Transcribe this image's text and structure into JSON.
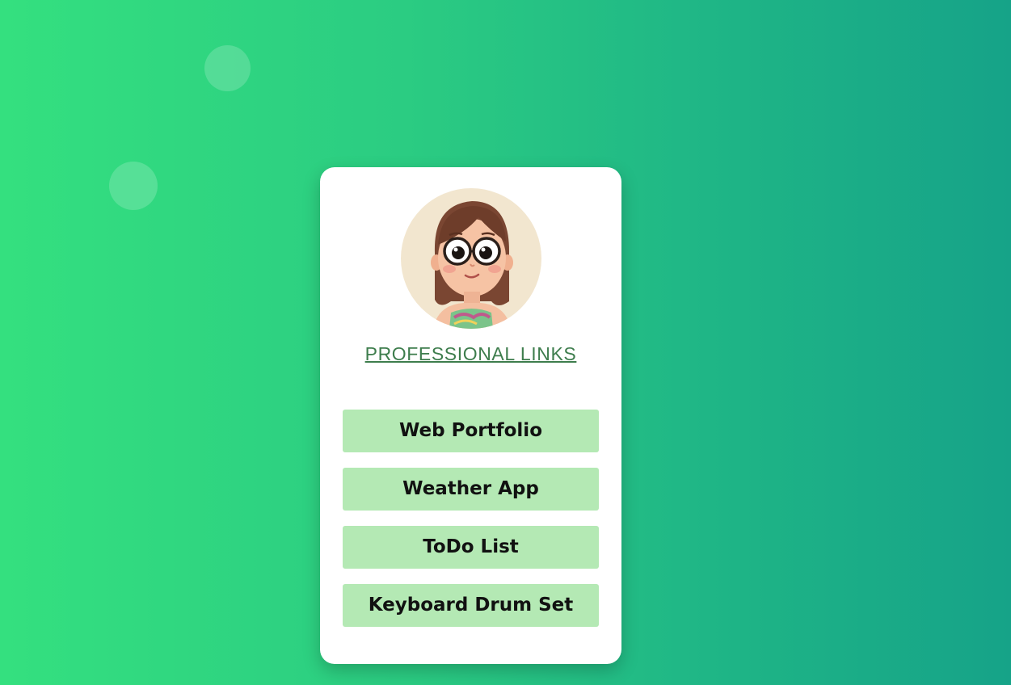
{
  "page": {
    "background_colors": [
      "#34e07f",
      "#16a388"
    ]
  },
  "profile": {
    "avatar_icon": "cartoon-girl-with-glasses-avatar",
    "title": "PROFESSIONAL LINKS",
    "title_color": "#3e7d4d"
  },
  "links": {
    "button_color": "#b4e9b4",
    "items": [
      {
        "label": "Web Portfolio"
      },
      {
        "label": "Weather App"
      },
      {
        "label": "ToDo List"
      },
      {
        "label": "Keyboard Drum Set"
      }
    ]
  }
}
